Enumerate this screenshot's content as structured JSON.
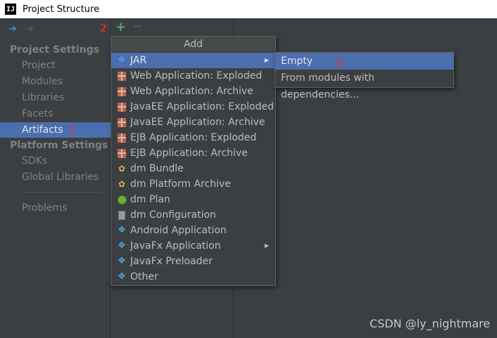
{
  "window": {
    "title": "Project Structure",
    "logo": "IJ"
  },
  "toolbar": {
    "back_icon": "arrow-left-icon",
    "forward_icon": "arrow-right-icon",
    "add_symbol": "+",
    "remove_symbol": "−",
    "annotation": "2"
  },
  "sidebar": {
    "project_settings_header": "Project Settings",
    "project_settings_items": [
      "Project",
      "Modules",
      "Libraries",
      "Facets",
      "Artifacts"
    ],
    "selected_item": "Artifacts",
    "selected_annotation": "1",
    "platform_settings_header": "Platform Settings",
    "platform_settings_items": [
      "SDKs",
      "Global Libraries"
    ],
    "problems_item": "Problems"
  },
  "add_popup": {
    "title": "Add",
    "items": [
      {
        "label": "JAR",
        "icon": "diamond-icon",
        "submenu": true,
        "active": true
      },
      {
        "label": "Web Application: Exploded",
        "icon": "gift-icon"
      },
      {
        "label": "Web Application: Archive",
        "icon": "gift-icon"
      },
      {
        "label": "JavaEE Application: Exploded",
        "icon": "gift-icon"
      },
      {
        "label": "JavaEE Application: Archive",
        "icon": "gift-icon"
      },
      {
        "label": "EJB Application: Exploded",
        "icon": "gift-icon"
      },
      {
        "label": "EJB Application: Archive",
        "icon": "gift-icon"
      },
      {
        "label": "dm Bundle",
        "icon": "bundle-icon"
      },
      {
        "label": "dm Platform Archive",
        "icon": "bundle-icon"
      },
      {
        "label": "dm Plan",
        "icon": "globe-icon"
      },
      {
        "label": "dm Configuration",
        "icon": "document-icon"
      },
      {
        "label": "Android Application",
        "icon": "diamond-icon"
      },
      {
        "label": "JavaFx Application",
        "icon": "diamond-icon",
        "submenu": true
      },
      {
        "label": "JavaFx Preloader",
        "icon": "diamond-icon"
      },
      {
        "label": "Other",
        "icon": "diamond-icon"
      }
    ]
  },
  "jar_submenu": {
    "items": [
      "Empty",
      "From modules with dependencies..."
    ],
    "active_item": "Empty",
    "annotation": "3"
  },
  "watermark": "CSDN @ly_nightmare",
  "colors": {
    "selection": "#4b6eaf",
    "annotation": "#ff2a2a",
    "add_green": "#59a869",
    "background": "#3c3f41"
  }
}
